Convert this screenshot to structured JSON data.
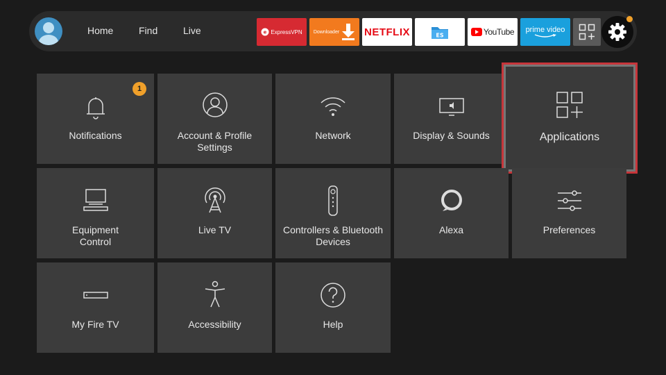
{
  "nav": {
    "home_label": "Home",
    "find_label": "Find",
    "live_label": "Live"
  },
  "apps": {
    "expressvpn": "ExpressVPN",
    "downloader": "Downloader",
    "netflix": "NETFLIX",
    "es": "ES",
    "youtube": "YouTube",
    "prime_video_line1": "prime video"
  },
  "settings": {
    "notifications": "Notifications",
    "notifications_badge": "1",
    "account_line1": "Account & Profile",
    "account_line2": "Settings",
    "network": "Network",
    "display_sounds": "Display & Sounds",
    "applications": "Applications",
    "equipment_line1": "Equipment",
    "equipment_line2": "Control",
    "live_tv": "Live TV",
    "controllers_line1": "Controllers & Bluetooth",
    "controllers_line2": "Devices",
    "alexa": "Alexa",
    "preferences": "Preferences",
    "my_fire_tv": "My Fire TV",
    "accessibility": "Accessibility",
    "help": "Help"
  },
  "colors": {
    "background": "#1b1b1b",
    "tile": "#3c3c3c",
    "focus_border": "#c7353a",
    "badge": "#f0a02a",
    "expressvpn": "#d62a32",
    "downloader": "#f27a1e",
    "prime_video": "#1aa0dd"
  }
}
